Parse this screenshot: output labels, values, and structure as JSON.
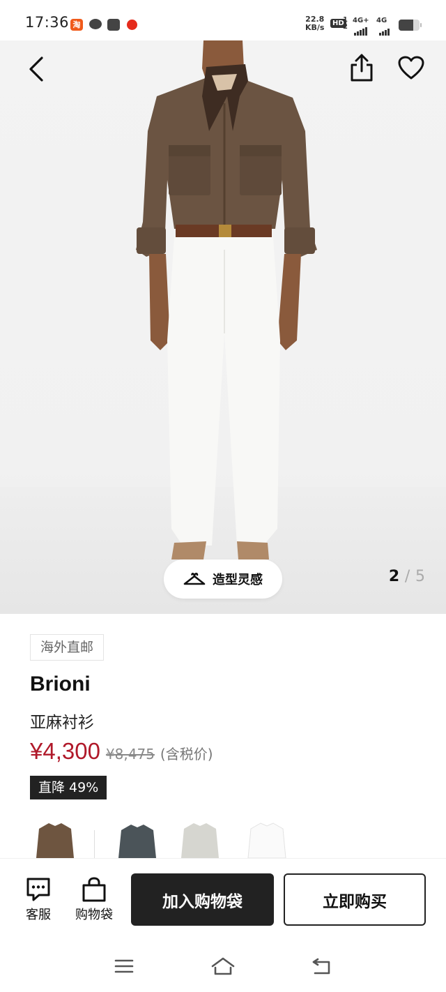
{
  "status_bar": {
    "time": "17:36",
    "net_speed_value": "22.8",
    "net_speed_unit": "KB/s",
    "hd_badge": "HD",
    "sim_slots": "1\n2",
    "network_1": "4G+",
    "network_2": "4G",
    "battery_level": 0.7,
    "app_icons": [
      "taobao-icon",
      "chat-bubble-icon",
      "mail-icon",
      "red-notification-icon"
    ]
  },
  "hero": {
    "styling_inspiration_label": "造型灵感",
    "page_current": "2",
    "page_separator": "/",
    "page_total": "5",
    "icons": [
      "back-arrow-icon",
      "share-icon",
      "heart-icon",
      "hanger-icon"
    ]
  },
  "product": {
    "shipping_tag": "海外直邮",
    "brand": "Brioni",
    "name": "亚麻衬衫",
    "price": "¥4,300",
    "original_price": "¥8,475",
    "tax_note": "(含税价)",
    "discount_badge": "直降 49%",
    "swatches": [
      {
        "color": "#6e5540",
        "label": "brown-shirt"
      },
      {
        "color": "#4b5459",
        "label": "slate-shirt"
      },
      {
        "color": "#d6d6d0",
        "label": "grey-shirt"
      },
      {
        "color": "#fafafa",
        "label": "white-shirt"
      }
    ]
  },
  "action_bar": {
    "customer_service_label": "客服",
    "shopping_bag_label": "购物袋",
    "add_to_bag_label": "加入购物袋",
    "buy_now_label": "立即购买"
  },
  "system_nav": {
    "icons": [
      "menu-icon",
      "home-icon",
      "back-icon"
    ]
  }
}
